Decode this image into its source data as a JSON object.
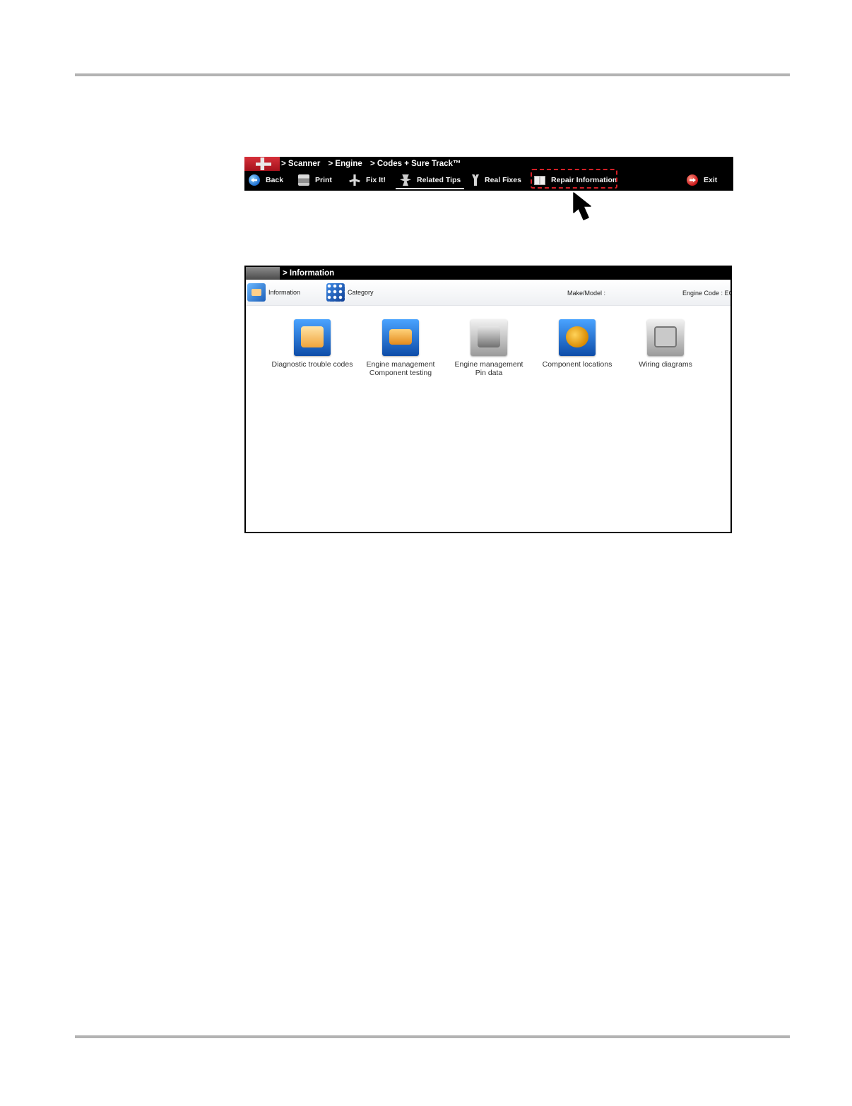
{
  "toolbar": {
    "breadcrumbs": [
      "> Scanner",
      "> Engine",
      "> Codes + Sure Track™"
    ],
    "buttons": {
      "back": "Back",
      "print": "Print",
      "fix_it": "Fix It!",
      "related_tips": "Related Tips",
      "real_fixes": "Real Fixes",
      "repair_information": "Repair Information",
      "exit": "Exit"
    },
    "active_tab": "Related Tips",
    "highlighted_button": "Repair Information",
    "highlight_color": "#d41f26"
  },
  "info_window": {
    "title": "> Information",
    "bar": {
      "information_label": "Information",
      "category_label": "Category",
      "make_model_label": "Make/Model :",
      "engine_code_label": "Engine Code : ECN"
    },
    "tiles": [
      {
        "line1": "Diagnostic trouble codes",
        "line2": "",
        "icon": "dtc-icon"
      },
      {
        "line1": "Engine management",
        "line2": "Component testing",
        "icon": "ecm-component-icon"
      },
      {
        "line1": "Engine management",
        "line2": "Pin data",
        "icon": "pin-data-icon"
      },
      {
        "line1": "Component locations",
        "line2": "",
        "icon": "component-locations-icon"
      },
      {
        "line1": "Wiring diagrams",
        "line2": "",
        "icon": "wiring-diagrams-icon"
      }
    ]
  }
}
